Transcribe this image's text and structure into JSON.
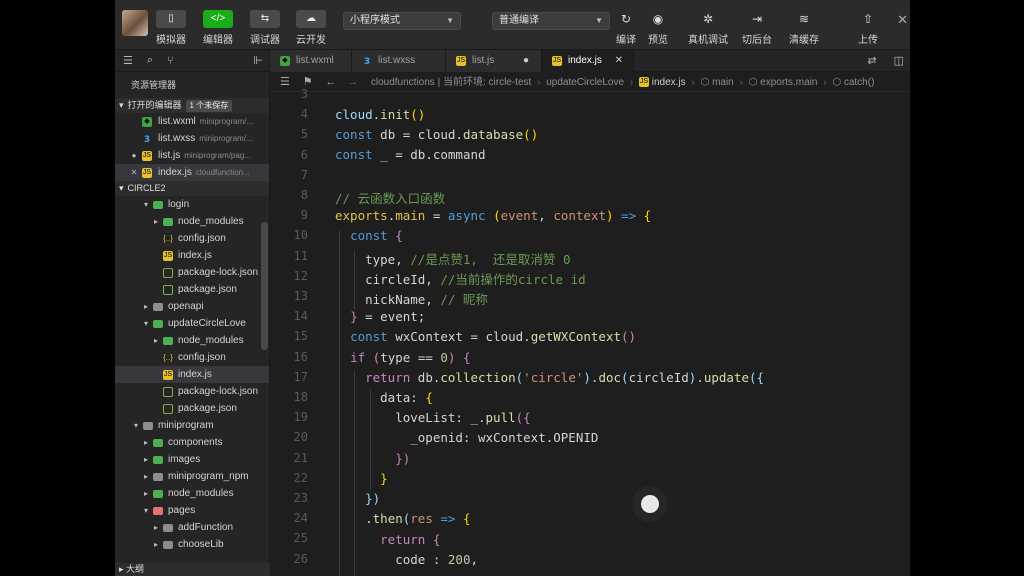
{
  "toolbar": {
    "buttons": [
      {
        "label": "模拟器",
        "icon": "phone-icon"
      },
      {
        "label": "编辑器",
        "icon": "code-icon"
      },
      {
        "label": "调试器",
        "icon": "debug-icon"
      },
      {
        "label": "云开发",
        "icon": "cloud-icon"
      }
    ],
    "mode_select": "小程序模式",
    "compile_select": "普通编译",
    "actions": [
      {
        "label": "编译",
        "icon": "refresh-icon"
      },
      {
        "label": "预览",
        "icon": "eye-icon"
      },
      {
        "label": "真机调试",
        "icon": "bug-icon"
      },
      {
        "label": "切后台",
        "icon": "switch-icon"
      },
      {
        "label": "清缓存",
        "icon": "layers-icon"
      },
      {
        "label": "上传",
        "icon": "upload-icon"
      }
    ]
  },
  "sidebar": {
    "title": "资源管理器",
    "open_editors": {
      "label": "打开的编辑器",
      "badge": "1 个未保存"
    },
    "open_files": [
      {
        "name": "list.wxml",
        "path": "miniprogram/...",
        "type": "wxml",
        "lead": ""
      },
      {
        "name": "list.wxss",
        "path": "miniprogram/...",
        "type": "wxss",
        "lead": ""
      },
      {
        "name": "list.js",
        "path": "miniprogram/pag...",
        "type": "js",
        "lead": "●"
      },
      {
        "name": "index.js",
        "path": "cloudfunction...",
        "type": "js",
        "lead": "✕"
      }
    ],
    "project": "CIRCLE2",
    "tree": [
      {
        "name": "login",
        "depth": 1,
        "arrow": "▾",
        "type": "fold-g"
      },
      {
        "name": "node_modules",
        "depth": 2,
        "arrow": "▸",
        "type": "fold-g"
      },
      {
        "name": "config.json",
        "depth": 2,
        "arrow": "",
        "type": "json"
      },
      {
        "name": "index.js",
        "depth": 2,
        "arrow": "",
        "type": "js"
      },
      {
        "name": "package-lock.json",
        "depth": 2,
        "arrow": "",
        "type": "pkg"
      },
      {
        "name": "package.json",
        "depth": 2,
        "arrow": "",
        "type": "pkg"
      },
      {
        "name": "openapi",
        "depth": 1,
        "arrow": "▸",
        "type": "fold"
      },
      {
        "name": "updateCircleLove",
        "depth": 1,
        "arrow": "▾",
        "type": "fold-g"
      },
      {
        "name": "node_modules",
        "depth": 2,
        "arrow": "▸",
        "type": "fold-g"
      },
      {
        "name": "config.json",
        "depth": 2,
        "arrow": "",
        "type": "json"
      },
      {
        "name": "index.js",
        "depth": 2,
        "arrow": "",
        "type": "js",
        "selected": true
      },
      {
        "name": "package-lock.json",
        "depth": 2,
        "arrow": "",
        "type": "pkg"
      },
      {
        "name": "package.json",
        "depth": 2,
        "arrow": "",
        "type": "pkg"
      },
      {
        "name": "miniprogram",
        "depth": 0,
        "arrow": "▾",
        "type": "fold"
      },
      {
        "name": "components",
        "depth": 1,
        "arrow": "▸",
        "type": "fold-g"
      },
      {
        "name": "images",
        "depth": 1,
        "arrow": "▸",
        "type": "fold-g"
      },
      {
        "name": "miniprogram_npm",
        "depth": 1,
        "arrow": "▸",
        "type": "fold"
      },
      {
        "name": "node_modules",
        "depth": 1,
        "arrow": "▸",
        "type": "fold-g"
      },
      {
        "name": "pages",
        "depth": 1,
        "arrow": "▾",
        "type": "fold-r"
      },
      {
        "name": "addFunction",
        "depth": 2,
        "arrow": "▸",
        "type": "fold"
      },
      {
        "name": "chooseLib",
        "depth": 2,
        "arrow": "▸",
        "type": "fold"
      }
    ],
    "outline": "大纲"
  },
  "tabs": [
    {
      "name": "list.wxml",
      "type": "wxml",
      "width": 82
    },
    {
      "name": "list.wxss",
      "type": "wxss",
      "width": 94
    },
    {
      "name": "list.js",
      "type": "js",
      "width": 96,
      "dirty": true
    },
    {
      "name": "index.js",
      "type": "js",
      "width": 92,
      "active": true
    }
  ],
  "breadcrumb": {
    "path": "cloudfunctions | 当前环境: circle-test",
    "items": [
      "updateCircleLove",
      "index.js",
      "main",
      "exports.main",
      "catch()"
    ]
  },
  "code": {
    "line_numbers": [
      "3",
      "4",
      "5",
      "6",
      "7",
      "8",
      "9",
      "10",
      "11",
      "12",
      "13",
      "14",
      "15",
      "16",
      "17",
      "18",
      "19",
      "20",
      "21",
      "22",
      "23",
      "24",
      "25",
      "26"
    ]
  }
}
